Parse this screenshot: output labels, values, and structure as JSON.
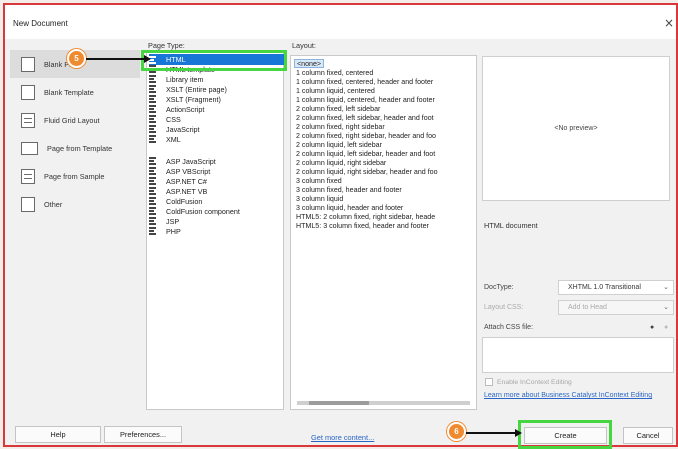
{
  "window": {
    "title": "New Document",
    "close_glyph": "×"
  },
  "categories": [
    {
      "label": "Blank Page",
      "icon": "blank-page-icon",
      "selected": true
    },
    {
      "label": "Blank Template",
      "icon": "blank-template-icon",
      "selected": false
    },
    {
      "label": "Fluid Grid Layout",
      "icon": "fluid-grid-icon",
      "selected": false
    },
    {
      "label": "Page from Template",
      "icon": "page-template-icon",
      "selected": false
    },
    {
      "label": "Page from Sample",
      "icon": "page-sample-icon",
      "selected": false
    },
    {
      "label": "Other",
      "icon": "other-icon",
      "selected": false
    }
  ],
  "page_type": {
    "label": "Page Type:",
    "items": [
      "HTML",
      "HTML template",
      "Library item",
      "XSLT (Entire page)",
      "XSLT (Fragment)",
      "ActionScript",
      "CSS",
      "JavaScript",
      "XML",
      "ASP JavaScript",
      "ASP VBScript",
      "ASP.NET C#",
      "ASP.NET VB",
      "ColdFusion",
      "ColdFusion component",
      "JSP",
      "PHP"
    ],
    "selected": "HTML"
  },
  "layout": {
    "label": "Layout:",
    "items": [
      "<none>",
      "1 column fixed, centered",
      "1 column fixed, centered, header and footer",
      "1 column liquid, centered",
      "1 column liquid, centered, header and footer",
      "2 column fixed, left sidebar",
      "2 column fixed, left sidebar, header and foot",
      "2 column fixed, right sidebar",
      "2 column fixed, right sidebar, header and foo",
      "2 column liquid, left sidebar",
      "2 column liquid, left sidebar, header and foot",
      "2 column liquid, right sidebar",
      "2 column liquid, right sidebar, header and foo",
      "3 column fixed",
      "3 column fixed, header and footer",
      "3 column liquid",
      "3 column liquid, header and footer",
      "HTML5: 2 column fixed, right sidebar, heade",
      "HTML5: 3 column fixed, header and footer"
    ],
    "selected": "<none>"
  },
  "preview": {
    "placeholder": "<No preview>",
    "description": "HTML document"
  },
  "doctype": {
    "label": "DocType:",
    "value": "XHTML 1.0 Transitional"
  },
  "layout_css": {
    "label": "Layout CSS:",
    "value": "Add to Head"
  },
  "attach_css": {
    "label": "Attach CSS file:"
  },
  "incontext": {
    "label": "Enable InContext Editing",
    "checked": false
  },
  "learn_more": {
    "text": "Learn more about Business Catalyst InContext Editing"
  },
  "footer": {
    "help": "Help",
    "preferences": "Preferences...",
    "get_more": "Get more content...",
    "create": "Create",
    "cancel": "Cancel"
  },
  "annotations": {
    "step_a": "5",
    "step_b": "6",
    "badge_color": "#f08a2f",
    "highlight_color": "#45d642"
  }
}
